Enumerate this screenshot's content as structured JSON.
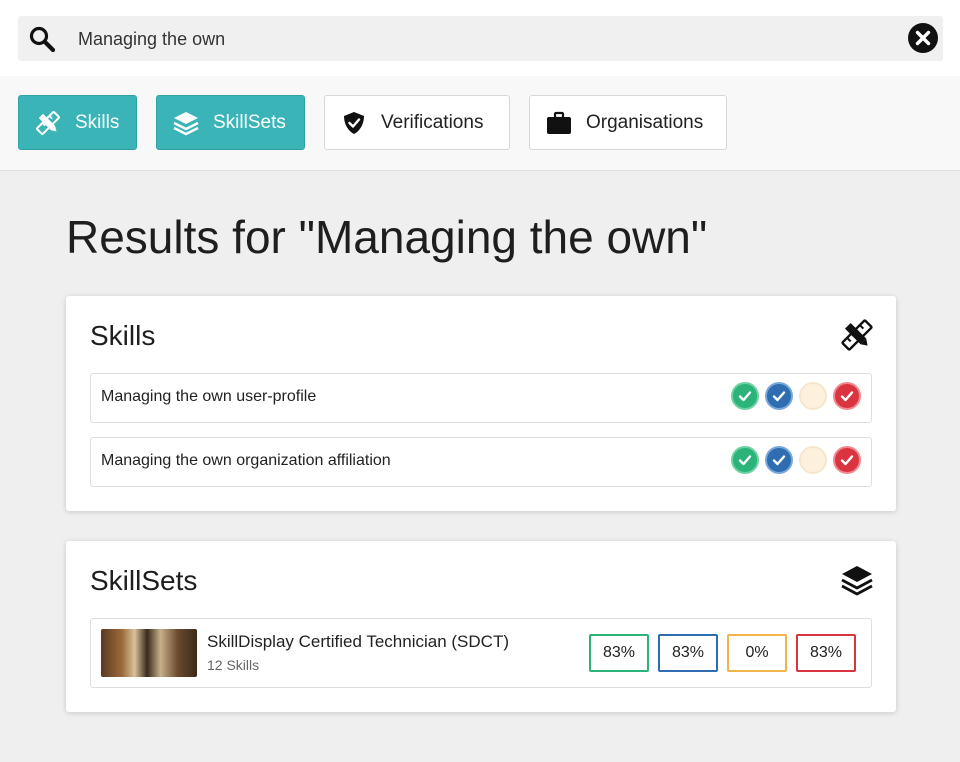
{
  "search": {
    "value": "Managing the own",
    "placeholder": ""
  },
  "tabs": [
    {
      "label": "Skills",
      "icon": "pencil-ruler-icon",
      "active": true
    },
    {
      "label": "SkillSets",
      "icon": "layers-icon",
      "active": true
    },
    {
      "label": "Verifications",
      "icon": "shield-check-icon",
      "active": false
    },
    {
      "label": "Organisations",
      "icon": "briefcase-icon",
      "active": false
    }
  ],
  "results": {
    "title": "Results for \"Managing the own\""
  },
  "skills": {
    "title": "Skills",
    "icon": "pencil-ruler-icon",
    "items": [
      {
        "label": "Managing the own user-profile",
        "badges": [
          "green",
          "blue",
          "cream",
          "red"
        ]
      },
      {
        "label": "Managing the own organization affiliation",
        "badges": [
          "green",
          "blue",
          "cream",
          "red"
        ]
      }
    ]
  },
  "skillsets": {
    "title": "SkillSets",
    "icon": "layers-icon",
    "items": [
      {
        "name": "SkillDisplay Certified Technician (SDCT)",
        "count": "12 Skills",
        "progress": [
          {
            "value": "83%",
            "color": "#2bb37a"
          },
          {
            "value": "83%",
            "color": "#2d6db0"
          },
          {
            "value": "0%",
            "color": "#f0b44a"
          },
          {
            "value": "83%",
            "color": "#d9343f"
          }
        ]
      }
    ]
  },
  "colors": {
    "accent": "#3bb4b8",
    "green": "#2bb37a",
    "blue": "#2d6db0",
    "yellow": "#f0b44a",
    "red": "#d9343f"
  }
}
